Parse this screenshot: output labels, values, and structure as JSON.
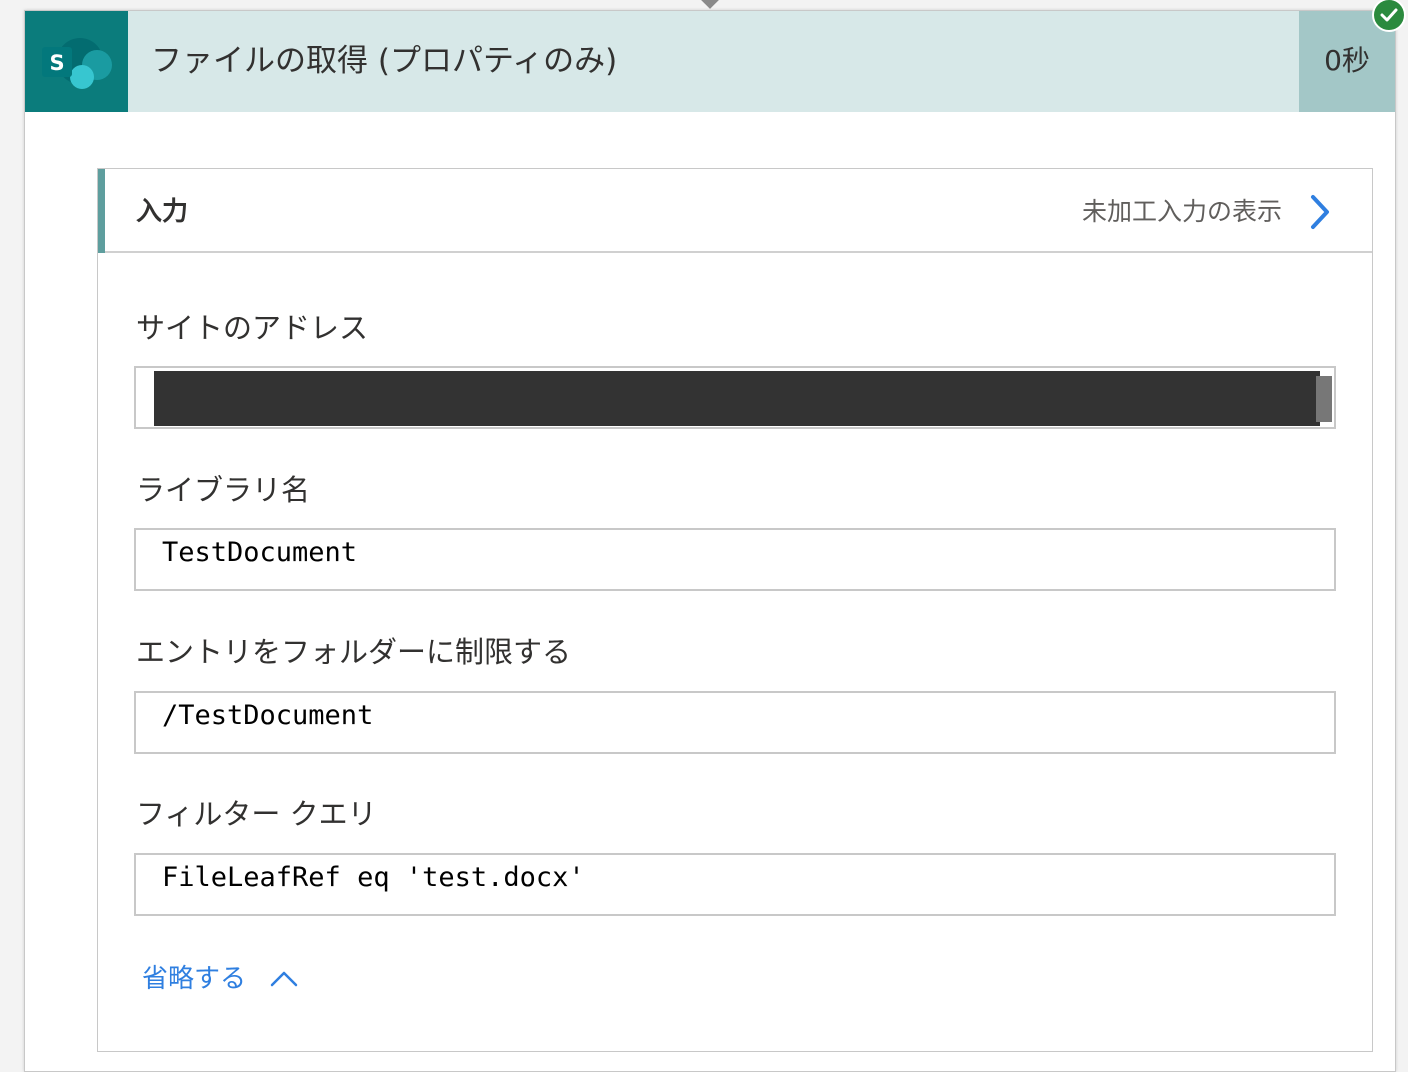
{
  "card": {
    "title": "ファイルの取得 (プロパティのみ)",
    "duration": "0秒",
    "app_icon": "sharepoint-icon",
    "status_icon": "check-icon",
    "status": "succeeded"
  },
  "inputs": {
    "header": "入力",
    "raw_link": "未加工入力の表示",
    "raw_link_icon": "chevron-right-icon",
    "fields": [
      {
        "label": "サイトのアドレス",
        "value": "",
        "redacted": true
      },
      {
        "label": "ライブラリ名",
        "value": "TestDocument"
      },
      {
        "label": "エントリをフォルダーに制限する",
        "value": "/TestDocument"
      },
      {
        "label": "フィルター クエリ",
        "value": "FileLeafRef eq 'test.docx'"
      }
    ],
    "collapse_label": "省略する",
    "collapse_icon": "chevron-up-icon"
  },
  "colors": {
    "brand": "#0b7c7c",
    "header_bg": "#d7e8e8",
    "duration_bg": "#a3c7c7",
    "link": "#2f7fe0",
    "success": "#2b8a3e"
  }
}
